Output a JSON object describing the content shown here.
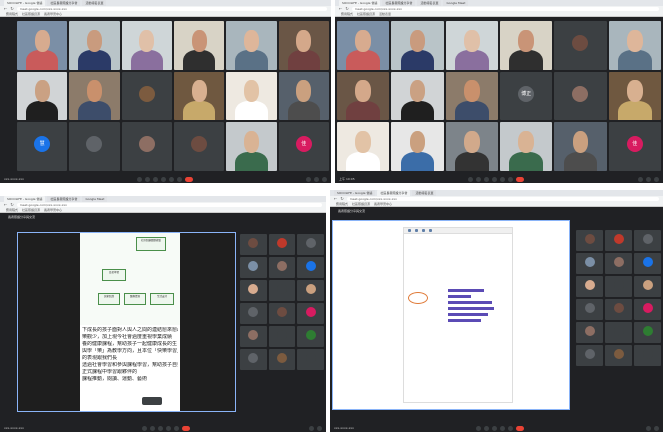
{
  "browser": {
    "tabs": [
      "SOCOLIFE - Google 會議",
      "社區長者照護分享會",
      "活動報名表單",
      "Google Meet"
    ],
    "url": "meet.google.com/xxx-xxxx-xxx",
    "bookmarks": [
      "應用程式",
      "社區照護資源",
      "長者學習中心",
      "活動表單"
    ]
  },
  "meeting": {
    "code": "xxx-xxxx-xxx",
    "time": "上午 10:05",
    "present_title": "長者照護分享與交流"
  },
  "panelA": {
    "tiles": [
      {
        "kind": "photo",
        "label": "",
        "skin": "#d7ab8f",
        "shirt": "#c95b5b",
        "bg": "#7b8fa6"
      },
      {
        "kind": "photo",
        "label": "",
        "skin": "#c99b7e",
        "shirt": "#2b3a67",
        "bg": "#b9c4c8"
      },
      {
        "kind": "photo",
        "label": "",
        "skin": "#e0c0a8",
        "shirt": "#8a6f9e",
        "bg": "#cfd6d8"
      },
      {
        "kind": "photo",
        "label": "",
        "skin": "#c99477",
        "shirt": "#2f2f2f",
        "bg": "#d8d3c6"
      },
      {
        "kind": "photo",
        "label": "",
        "skin": "#deb69a",
        "shirt": "#5a7186",
        "bg": "#a9b6bd"
      },
      {
        "kind": "photo",
        "label": "",
        "skin": "#d4a88a",
        "shirt": "#704040",
        "bg": "#6a5646"
      },
      {
        "kind": "photo",
        "label": "",
        "skin": "#caa183",
        "shirt": "#1f1f1f",
        "bg": "#d1d4d6"
      },
      {
        "kind": "photo",
        "label": "",
        "skin": "#c9906c",
        "shirt": "#3d4d6a",
        "bg": "#8c7b6a"
      },
      {
        "kind": "avatar",
        "label": "",
        "letter": "",
        "color": "#7c5b3f"
      },
      {
        "kind": "photo",
        "label": "",
        "skin": "#d8b090",
        "shirt": "#c7a96a",
        "bg": "#6f5840"
      },
      {
        "kind": "photo",
        "label": "",
        "skin": "#e2c3a6",
        "shirt": "#ffffff",
        "bg": "#eee9e1"
      },
      {
        "kind": "photo",
        "label": "",
        "skin": "#caa07f",
        "shirt": "#4d4d4d",
        "bg": "#56606b"
      },
      {
        "kind": "avatar",
        "label": "",
        "letter": "慧",
        "color": "#1a73e8"
      },
      {
        "kind": "avatar",
        "label": "",
        "letter": "",
        "color": "#5f6368"
      },
      {
        "kind": "avatar",
        "label": "",
        "letter": "",
        "color": "#8d6e63"
      },
      {
        "kind": "avatar",
        "label": "",
        "letter": "",
        "color": "#6d4c41"
      },
      {
        "kind": "photo",
        "label": "",
        "skin": "#d9b394",
        "shirt": "#3a6b4d",
        "bg": "#c4c9cc"
      },
      {
        "kind": "avatar",
        "label": "",
        "letter": "佳",
        "color": "#d81b60"
      }
    ]
  },
  "panelB": {
    "tiles": [
      {
        "kind": "photo",
        "label": "",
        "skin": "#d7ab8f",
        "shirt": "#c95b5b",
        "bg": "#7b8fa6"
      },
      {
        "kind": "photo",
        "label": "",
        "skin": "#c99b7e",
        "shirt": "#2b3a67",
        "bg": "#b9c4c8"
      },
      {
        "kind": "photo",
        "label": "",
        "skin": "#e0c0a8",
        "shirt": "#8a6f9e",
        "bg": "#cfd6d8"
      },
      {
        "kind": "photo",
        "label": "",
        "skin": "#c99477",
        "shirt": "#2f2f2f",
        "bg": "#d8d3c6"
      },
      {
        "kind": "avatar",
        "label": "",
        "letter": "",
        "color": "#6d4c41"
      },
      {
        "kind": "photo",
        "label": "",
        "skin": "#deb69a",
        "shirt": "#5a7186",
        "bg": "#a9b6bd"
      },
      {
        "kind": "photo",
        "label": "",
        "skin": "#d4a88a",
        "shirt": "#704040",
        "bg": "#6a5646"
      },
      {
        "kind": "photo",
        "label": "",
        "skin": "#caa183",
        "shirt": "#1f1f1f",
        "bg": "#d1d4d6"
      },
      {
        "kind": "photo",
        "label": "",
        "skin": "#c9906c",
        "shirt": "#3d4d6a",
        "bg": "#8c7b6a"
      },
      {
        "kind": "avatar",
        "label": "",
        "letter": "博正",
        "color": "#5f6368"
      },
      {
        "kind": "avatar",
        "label": "",
        "letter": "",
        "color": "#8d6e63"
      },
      {
        "kind": "photo",
        "label": "",
        "skin": "#d8b090",
        "shirt": "#c7a96a",
        "bg": "#6f5840"
      },
      {
        "kind": "photo",
        "label": "",
        "skin": "#e2c3a6",
        "shirt": "#ffffff",
        "bg": "#eee9e1"
      },
      {
        "kind": "photo",
        "label": "",
        "skin": "#caa07f",
        "shirt": "#3b6da8",
        "bg": "#e7e7e7"
      },
      {
        "kind": "photo",
        "label": "",
        "skin": "#d1a98b",
        "shirt": "#333333",
        "bg": "#7d848a"
      },
      {
        "kind": "photo",
        "label": "",
        "skin": "#d9b394",
        "shirt": "#3a6b4d",
        "bg": "#c4c9cc"
      },
      {
        "kind": "photo",
        "label": "",
        "skin": "#caa07f",
        "shirt": "#4d4d4d",
        "bg": "#56606b"
      },
      {
        "kind": "avatar",
        "label": "",
        "letter": "佳",
        "color": "#d81b60"
      }
    ]
  },
  "panelC": {
    "flow": [
      "社區照顧關懷據點",
      "長者學習",
      "居家照護",
      "醫療資源",
      "生活支持"
    ],
    "text_lines": [
      "下成長的孩子面對人與人之間的連結愈來愈疏",
      "樂觀少，加上現今社會過度重視學業成績",
      "養的健康課程，幫助孩子一起健康成長的生",
      "與學「樂」為教學方向，且本位「快樂學習」生",
      "的表現跟我們長",
      "透過社會學習和參與課程學習，幫助孩子自我提",
      "正式課程中學習跟夥伴的",
      "課程推動，閱讀、運動、藝術"
    ],
    "side_tiles": [
      "",
      "",
      "",
      "",
      "",
      "",
      "",
      "",
      "",
      "",
      "",
      "",
      "",
      "",
      "",
      "",
      "",
      ""
    ],
    "side_colors": [
      "#6d4c41",
      "#c0392b",
      "#5f6368",
      "#7b8fa6",
      "#8d6e63",
      "#1a73e8",
      "#d7ab8f",
      "#3c4043",
      "#caa07f",
      "#5f6368",
      "#6d4c41",
      "#d81b60",
      "#8d6e63",
      "#3c4043",
      "#2e7d32",
      "#5f6368",
      "#7c5b3f",
      "#3c4043"
    ]
  },
  "panelD": {
    "chart_title": "",
    "bars": [
      {
        "label": "",
        "value": 0.72
      },
      {
        "label": "",
        "value": 0.45
      },
      {
        "label": "",
        "value": 0.88
      },
      {
        "label": "",
        "value": 0.92
      },
      {
        "label": "",
        "value": 0.8
      },
      {
        "label": "",
        "value": 0.66
      }
    ],
    "side_colors": [
      "#6d4c41",
      "#c0392b",
      "#5f6368",
      "#7b8fa6",
      "#8d6e63",
      "#1a73e8",
      "#d7ab8f",
      "#3c4043",
      "#caa07f",
      "#5f6368",
      "#6d4c41",
      "#d81b60",
      "#8d6e63",
      "#3c4043",
      "#2e7d32",
      "#5f6368",
      "#7c5b3f",
      "#3c4043"
    ]
  }
}
